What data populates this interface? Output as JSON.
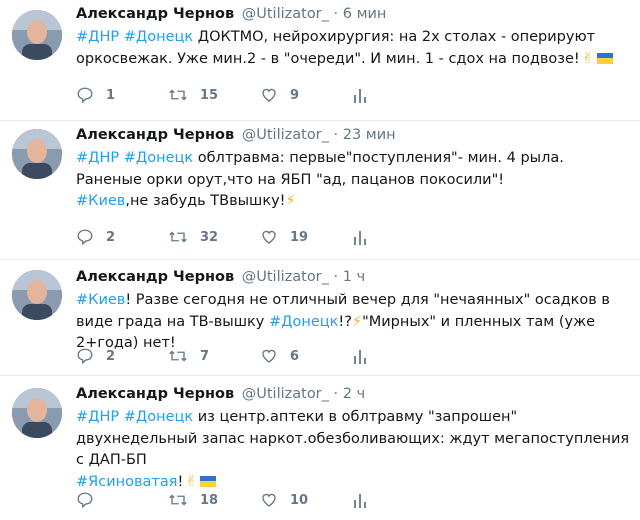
{
  "tweets": [
    {
      "name": "Александр Чернов",
      "handle": "@Utilizator_",
      "dot": "·",
      "time": "6 мин",
      "tag1": "#ДНР",
      "tag2": "#Донецк",
      "text1": "ДОКТМО, нейрохирургия: на 2х столах - оперируют оркосвежак. Уже мин.2 - в \"очереди\". И мин. 1 - сдох на подвозе!",
      "replies": "1",
      "retweets": "15",
      "likes": "9"
    },
    {
      "name": "Александр Чернов",
      "handle": "@Utilizator_",
      "dot": "·",
      "time": "23 мин",
      "tag1": "#ДНР",
      "tag2": "#Донецк",
      "text1": "облтравма: первые\"поступления\"- мин. 4 рыла.",
      "text2": "Раненые орки орут,что на ЯБП \"ад, пацанов покосили\"!",
      "tag3": "#Киев",
      "text3": ",не забудь ТВвышку!",
      "replies": "2",
      "retweets": "32",
      "likes": "19"
    },
    {
      "name": "Александр Чернов",
      "handle": "@Utilizator_",
      "dot": "·",
      "time": "1 ч",
      "tag1": "#Киев",
      "text1": "! Разве сегодня не отличный вечер для \"нечаянных\" осадков в виде града на ТВ-вышку ",
      "tag2": "#Донецк",
      "text2": "!?",
      "text3": "\"Мирных\" и пленных там (уже 2+года) нет!",
      "replies": "2",
      "retweets": "7",
      "likes": "6"
    },
    {
      "name": "Александр Чернов",
      "handle": "@Utilizator_",
      "dot": "·",
      "time": "2 ч",
      "tag1": "#ДНР",
      "tag2": "#Донецк",
      "text1": "из центр.аптеки в облтравму \"запрошен\" двухнедельный запас наркот.обезболивающих: ждут мегапоступления с ДАП-БП",
      "tag3": "#Ясиноватая",
      "text2": "!",
      "replies": "",
      "retweets": "18",
      "likes": "10"
    }
  ],
  "icons": {
    "reply": "reply-icon",
    "retweet": "retweet-icon",
    "like": "heart-icon",
    "analytics": "analytics-icon"
  },
  "colors": {
    "link": "#1da1f2",
    "muted": "#657786",
    "text": "#14171a",
    "divider": "#e6ecf0"
  }
}
